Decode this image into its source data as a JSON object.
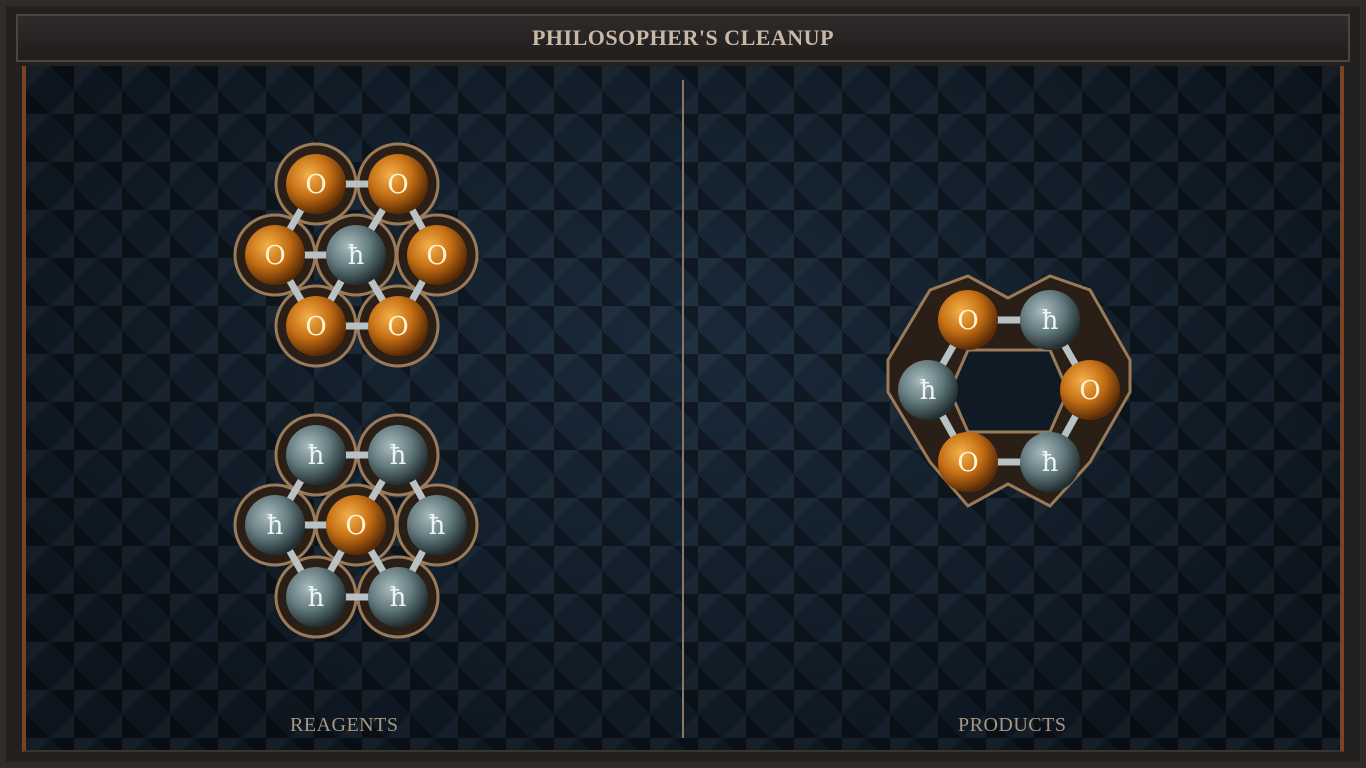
{
  "title": "PHILOSOPHER'S CLEANUP",
  "panels": {
    "reagents_label": "REAGENTS",
    "products_label": "PRODUCTS"
  },
  "molecules": [
    {
      "role": "reagent",
      "atoms": [
        "salt",
        "salt",
        "salt",
        "quicksilver",
        "salt",
        "salt",
        "salt"
      ]
    },
    {
      "role": "reagent",
      "atoms": [
        "quicksilver",
        "quicksilver",
        "quicksilver",
        "salt",
        "quicksilver",
        "quicksilver",
        "quicksilver"
      ]
    },
    {
      "role": "product",
      "atoms": [
        "salt",
        "quicksilver",
        "quicksilver",
        "salt",
        "salt",
        "quicksilver"
      ]
    }
  ],
  "symbols": {
    "salt": "O",
    "quicksilver": "ħ"
  },
  "colors": {
    "salt": "#c87a1e",
    "quicksilver": "#6f8589",
    "frame_accent": "#7a4324"
  }
}
